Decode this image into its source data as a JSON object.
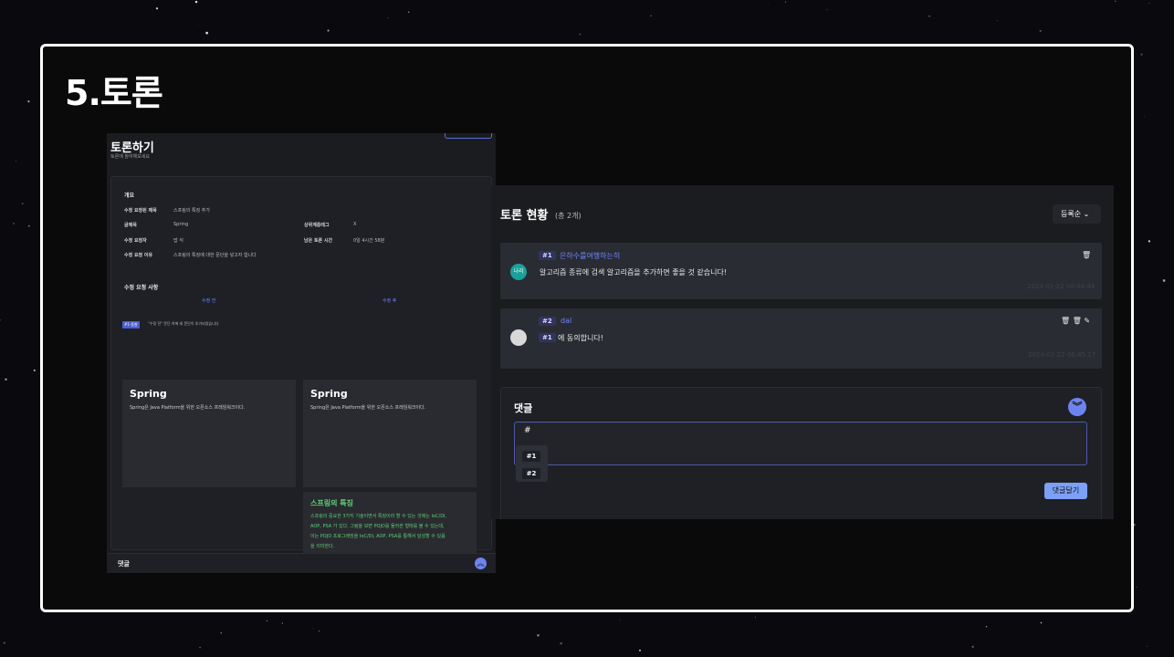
{
  "slide": {
    "title": "5.토론"
  },
  "left_screen": {
    "page_title": "토론하기",
    "page_subtitle": "토론에 참여해보세요",
    "overview_label": "개요",
    "fields": [
      {
        "key": "수정 요청된 제목",
        "value": "스프링의 특징 추가"
      },
      {
        "key": "글제목",
        "value": "Spring"
      },
      {
        "key": "상위계층태그",
        "value": "X"
      },
      {
        "key": "수정 요청자",
        "value": "밥 석"
      },
      {
        "key": "남은 토론 시간",
        "value": "0일 4시간 58분"
      },
      {
        "key": "수정 요청 이유",
        "value": "스프링의 특징에 대한 문단을 넣고자 합니다"
      }
    ],
    "changes_label": "수정 요청 사항",
    "before_label": "수정 전",
    "after_label": "수정 후",
    "badge": "#1-동향",
    "note": "\"수정 전\" 문단 하에 새 문단이 추가되었습니다",
    "before_box": {
      "heading": "Spring",
      "text": "Spring은 Java Platform을 위한 오픈소스 프레임워크이다."
    },
    "after_box": {
      "heading": "Spring",
      "text": "Spring은 Java Platform을 위한 오픈소스 프레임워크이다."
    },
    "added_box": {
      "heading": "스프링의 특징",
      "lines": [
        "스프링의 중요한 3가지 기술이면서 특징이라 할 수 있는 것에는 IoC/DI,",
        "AOP, PSA 가 있다. 그림을 보면 POJO를 둘러싼 형태를 볼 수 있는데,",
        "이는 POJO 프로그래밍을 IoC/DI, AOP, PSA를 통해서 달성할 수 있음",
        "을 의미한다."
      ]
    },
    "footer_label": "댓글",
    "footer_toggle": "︽"
  },
  "right_screen": {
    "title": "토론 현황",
    "count": "(총 2개)",
    "sort_label": "등록순 ⌄",
    "comments": [
      {
        "number": "#1",
        "author": "은하수를여행하는히",
        "avatar": "나리",
        "avatar_color": "#1aa19a",
        "text": "알고리즘 종류에 검색 알고리즘을 추가하면 좋을 것 같습니다!",
        "date": "2024-02-22 00:44:44",
        "actions": "🗑"
      },
      {
        "number": "#2",
        "author": "dal",
        "avatar": "",
        "avatar_color": "#d9d9d9",
        "reply_ref": "#1",
        "text": "에 동의합니다!",
        "date": "2024-02-22 00:45:17",
        "actions": "🗑 🗑 ✎"
      }
    ],
    "comment_box": {
      "label": "댓글",
      "toggle": "︾",
      "value": "#",
      "suggestions": [
        "#1",
        "#2"
      ],
      "submit": "댓글달기"
    }
  }
}
